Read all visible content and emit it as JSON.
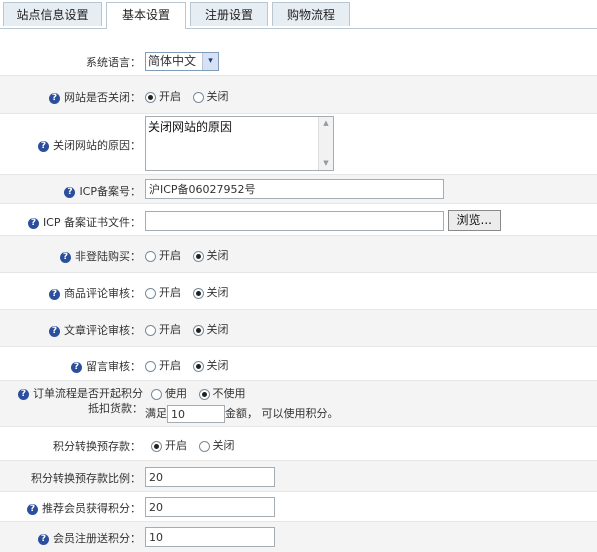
{
  "tabs": [
    {
      "label": "站点信息设置"
    },
    {
      "label": "基本设置"
    },
    {
      "label": "注册设置"
    },
    {
      "label": "购物流程"
    }
  ],
  "help_glyph": "?",
  "fields": {
    "language": {
      "label": "系统语言：",
      "value": "简体中文",
      "arrow": "▾"
    },
    "site_closed": {
      "label": "网站是否关闭：",
      "opt_on": "开启",
      "opt_off": "关闭",
      "selected": "开启"
    },
    "close_reason": {
      "label": "关闭网站的原因：",
      "value": "关闭网站的原因"
    },
    "icp": {
      "label": "ICP备案号：",
      "value": "沪ICP备06027952号"
    },
    "icp_file": {
      "label": "ICP 备案证书文件：",
      "value": "",
      "browse_label": "浏览..."
    },
    "anon_buy": {
      "label": "非登陆购买：",
      "opt_on": "开启",
      "opt_off": "关闭",
      "selected": "关闭"
    },
    "goods_review": {
      "label": "商品评论审核：",
      "opt_on": "开启",
      "opt_off": "关闭",
      "selected": "关闭"
    },
    "article_review": {
      "label": "文章评论审核：",
      "opt_on": "开启",
      "opt_off": "关闭",
      "selected": "关闭"
    },
    "message_review": {
      "label": "留言审核：",
      "opt_on": "开启",
      "opt_off": "关闭",
      "selected": "关闭"
    },
    "order_points": {
      "label_line1": "订单流程是否开起积分",
      "label_line2": "抵扣货款：",
      "opt_use": "使用",
      "opt_nouse": "不使用",
      "selected": "不使用",
      "prefix": "满足",
      "amount": "10",
      "suffix": "金额， 可以使用积分。"
    },
    "points_to_deposit": {
      "label": "积分转换预存款：",
      "opt_on": "开启",
      "opt_off": "关闭",
      "selected": "开启"
    },
    "points_ratio": {
      "label": "积分转换预存款比例：",
      "value": "20"
    },
    "referral_points": {
      "label": "推荐会员获得积分：",
      "value": "20"
    },
    "register_points": {
      "label": "会员注册送积分：",
      "value": "10"
    }
  }
}
